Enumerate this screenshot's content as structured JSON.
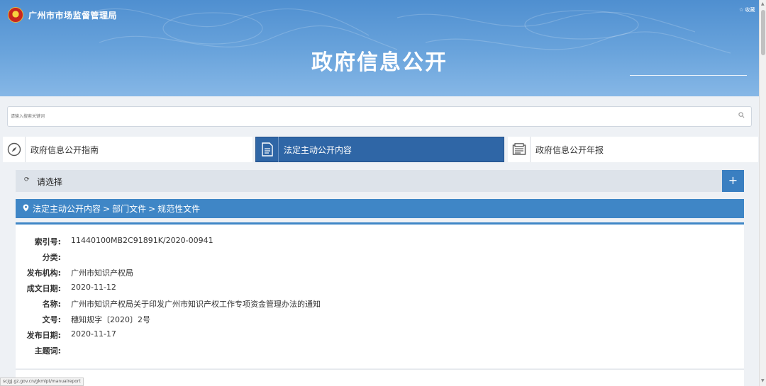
{
  "header": {
    "agency_name": "广州市市场监督管理局",
    "favorite_label": "☆ 收藏",
    "page_title": "政府信息公开"
  },
  "search": {
    "placeholder": "请输入搜索关键词"
  },
  "tabs": [
    {
      "label": "政府信息公开指南",
      "icon": "compass-icon",
      "active": false
    },
    {
      "label": "法定主动公开内容",
      "icon": "document-icon",
      "active": true
    },
    {
      "label": "政府信息公开年报",
      "icon": "newspaper-icon",
      "active": false
    }
  ],
  "selector": {
    "label": "请选择",
    "expand_label": "+"
  },
  "breadcrumb": {
    "items": [
      "法定主动公开内容",
      "部门文件",
      "规范性文件"
    ],
    "separator": ">"
  },
  "document_info": [
    {
      "label": "索引号:",
      "value": "11440100MB2C91891K/2020-00941"
    },
    {
      "label": "分类:",
      "value": ""
    },
    {
      "label": "发布机构:",
      "value": "广州市知识产权局"
    },
    {
      "label": "成文日期:",
      "value": "2020-11-12"
    },
    {
      "label": "名称:",
      "value": "广州市知识产权局关于印发广州市知识产权工作专项资金管理办法的通知"
    },
    {
      "label": "文号:",
      "value": "穗知规字〔2020〕2号"
    },
    {
      "label": "发布日期:",
      "value": "2020-11-17"
    },
    {
      "label": "主题词:",
      "value": ""
    }
  ],
  "status_bar": {
    "url": "scjgj.gz.gov.cn/gkmlpt/manualreport"
  },
  "colors": {
    "banner": "#5b98d6",
    "active_tab": "#2f66a6",
    "accent": "#3f86c6",
    "page_bg": "#eef1f5"
  }
}
